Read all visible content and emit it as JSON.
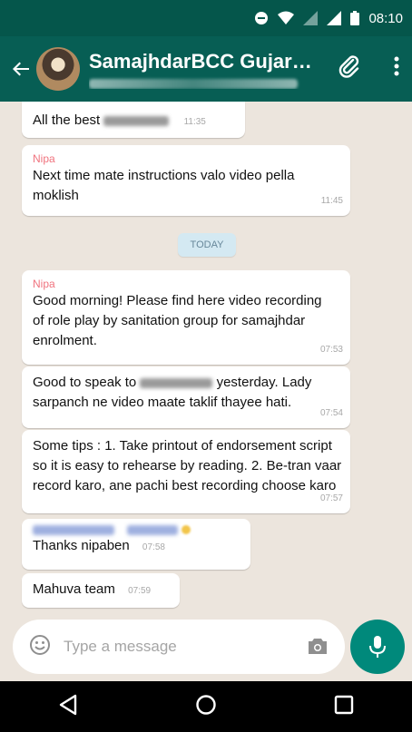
{
  "status_bar": {
    "time": "08:10"
  },
  "header": {
    "title": "SamajhdarBCC Gujarat..."
  },
  "messages": [
    {
      "text": "All the best",
      "time": "11:35"
    },
    {
      "sender": "Nipa",
      "text": "Next time mate instructions valo video pella moklish",
      "time": "11:45"
    },
    {
      "sender": "Nipa",
      "text": "Good morning! Please find here video recording of role play by sanitation group for samajhdar enrolment.",
      "time": "07:53"
    },
    {
      "text_before": "Good to speak to",
      "text_after": "yesterday. Lady sarpanch ne video maate taklif thayee hati.",
      "time": "07:54"
    },
    {
      "text": "Some tips : 1. Take printout of endorsement script so it is easy to rehearse by reading. 2. Be-tran vaar record karo, ane pachi  best recording choose karo",
      "time": "07:57"
    },
    {
      "text": "Thanks  nipaben",
      "time": "07:58"
    },
    {
      "text": "Mahuva team",
      "time": "07:59"
    }
  ],
  "date_chip": "TODAY",
  "composer": {
    "placeholder": "Type a message"
  },
  "colors": {
    "header": "#075e54",
    "status": "#05564b",
    "accent": "#00897b",
    "sender": "#f0737e",
    "chat_bg": "#ece5dd"
  }
}
